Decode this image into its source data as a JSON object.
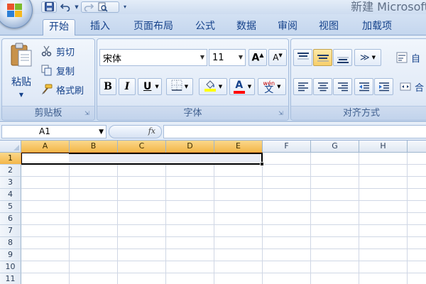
{
  "window": {
    "title": "新建 Microsoft"
  },
  "tabs": [
    {
      "label": "开始"
    },
    {
      "label": "插入"
    },
    {
      "label": "页面布局"
    },
    {
      "label": "公式"
    },
    {
      "label": "数据"
    },
    {
      "label": "审阅"
    },
    {
      "label": "视图"
    },
    {
      "label": "加载项"
    }
  ],
  "clipboard": {
    "paste_label": "粘贴",
    "cut_label": "剪切",
    "copy_label": "复制",
    "format_painter_label": "格式刷",
    "group_label": "剪贴板"
  },
  "font": {
    "font_name": "宋体",
    "font_size": "11",
    "bold": "B",
    "italic": "I",
    "underline": "U",
    "phonetic": "wén",
    "group_label": "字体"
  },
  "alignment": {
    "group_label": "对齐方式",
    "wrap_text_partial": "自",
    "merge_partial": "合"
  },
  "formula_bar": {
    "name_box": "A1",
    "fx": "fx",
    "value": ""
  },
  "sheet": {
    "columns": [
      "A",
      "B",
      "C",
      "D",
      "E",
      "F",
      "G",
      "H"
    ],
    "rows": [
      "1",
      "2",
      "3",
      "4",
      "5",
      "6",
      "7",
      "8",
      "9",
      "10",
      "11"
    ],
    "selected_range": "A1:E1",
    "active_cell": "A1"
  },
  "colors": {
    "ribbon_bg": "#dbe6f6",
    "header_selected": "#f3b64a",
    "fill_color_swatch": "#ffff00",
    "font_color_swatch": "#ff0000",
    "grid_line": "#d0d7e5"
  },
  "icons": {
    "office_button": "office-logo-icon",
    "save": "save-icon",
    "undo": "undo-icon",
    "redo": "redo-icon",
    "print_preview": "print-preview-icon",
    "customize": "qat-customize-icon"
  }
}
